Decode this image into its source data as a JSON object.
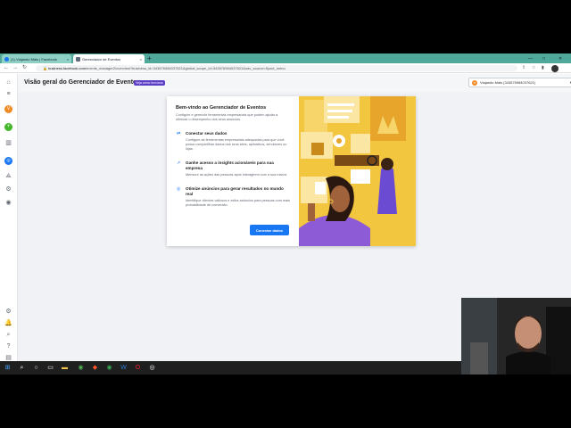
{
  "browser": {
    "tabs": [
      {
        "label": "(1) Viajando Mais | Facebook",
        "close": "×"
      },
      {
        "label": "Gerenciador de Eventos",
        "close": "×"
      }
    ],
    "new_tab": "+",
    "window_controls": [
      "—",
      "□",
      "✕"
    ],
    "url_domain": "business.facebook.com",
    "url_path": "/events_manager2/overview?business_id=343576984037621&global_scope_id=343576984037621&nav_source=flyout_menu"
  },
  "header": {
    "title": "Visão geral do Gerenciador de Eventos",
    "tour_badge": "Veja como funciona",
    "account_initial": "V",
    "account_label": "Viajando Mais (343576984037621)"
  },
  "modal": {
    "title": "Bem-vindo ao Gerenciador de Eventos",
    "subtitle": "Configure e gerencie ferramentas empresariais que podem ajudar a otimizar o desempenho dos seus anúncios.",
    "items": [
      {
        "title": "Conectar seus dados",
        "text": "Configure as ferramentas empresariais adequadas para que você possa compartilhar dados dos seus sites, aplicativos, servidores ou lojas."
      },
      {
        "title": "Ganhe acesso a insights acionáveis para sua empresa",
        "text": "Mensure as ações das pessoas após interagirem com a sua marca."
      },
      {
        "title": "Otimize anúncios para gerar resultados no mundo real",
        "text": "Identifique clientes valiosos e exiba anúncios para pessoas com mais probabilidade de conversão."
      }
    ],
    "connect_button": "Conectar dados"
  },
  "colors": {
    "accent": "#1877f2",
    "tab_bar": "#4fa89a",
    "illustration_bg": "#f3c63f",
    "badge": "#5b3cc4"
  },
  "icons": {
    "rail": [
      "facebook-icon",
      "menu-icon",
      "avatar-icon",
      "add-icon",
      "chart-icon",
      "events-icon",
      "people-icon",
      "gear-icon",
      "bell-icon",
      "search-icon",
      "help-icon",
      "report-icon"
    ],
    "taskbar": [
      "windows-icon",
      "search-icon",
      "cortana-icon",
      "task-view-icon",
      "explorer-icon",
      "chrome-icon",
      "brave-icon",
      "chrome-icon",
      "word-icon",
      "opera-icon",
      "obs-icon"
    ]
  }
}
